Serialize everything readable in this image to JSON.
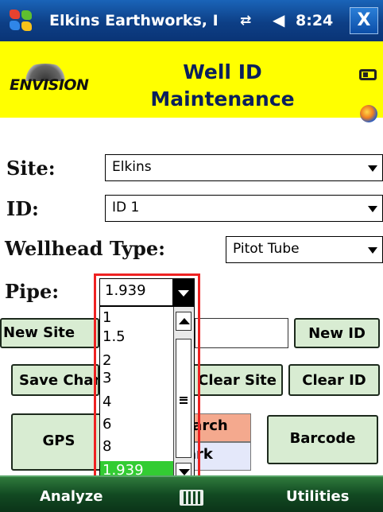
{
  "titlebar": {
    "title": "Elkins Earthworks, I",
    "time": "8:24",
    "close_label": "X",
    "icons": [
      "windows-start-icon",
      "network-icon",
      "volume-icon",
      "close-icon"
    ]
  },
  "header": {
    "logo_text": "ENVISION",
    "title_line1": "Well ID",
    "title_line2": "Maintenance",
    "icons": [
      "battery-icon",
      "globe-icon"
    ]
  },
  "form": {
    "site_label": "Site:",
    "site_value": "Elkins",
    "id_label": "ID:",
    "id_value": "ID 1",
    "wellhead_label": "Wellhead Type:",
    "wellhead_value": "Pitot Tube",
    "pipe_label": "Pipe:",
    "pipe_value": "1.939"
  },
  "buttons": {
    "new_site": "New Site",
    "new_id": "New ID",
    "save_changes": "Save Changes",
    "clear_site": "Clear Site",
    "clear_id": "Clear ID",
    "gps": "GPS",
    "search": "Search",
    "mark": "Mark",
    "barcode": "Barcode"
  },
  "pipe_dropdown": {
    "options": [
      "1",
      "1.5",
      "2",
      "3",
      "4",
      "6",
      "8",
      "1.939"
    ],
    "selected": "1.939"
  },
  "bottombar": {
    "left_softkey": "Analyze",
    "right_softkey": "Utilities",
    "center_icon": "keyboard-icon"
  },
  "colors": {
    "header_bg": "#ffff00",
    "button_bg": "#d8ecd2",
    "selection": "#33cc33",
    "highlight_border": "#ee2222",
    "titlebar": "#0d3f86",
    "bottombar": "#124a22"
  }
}
